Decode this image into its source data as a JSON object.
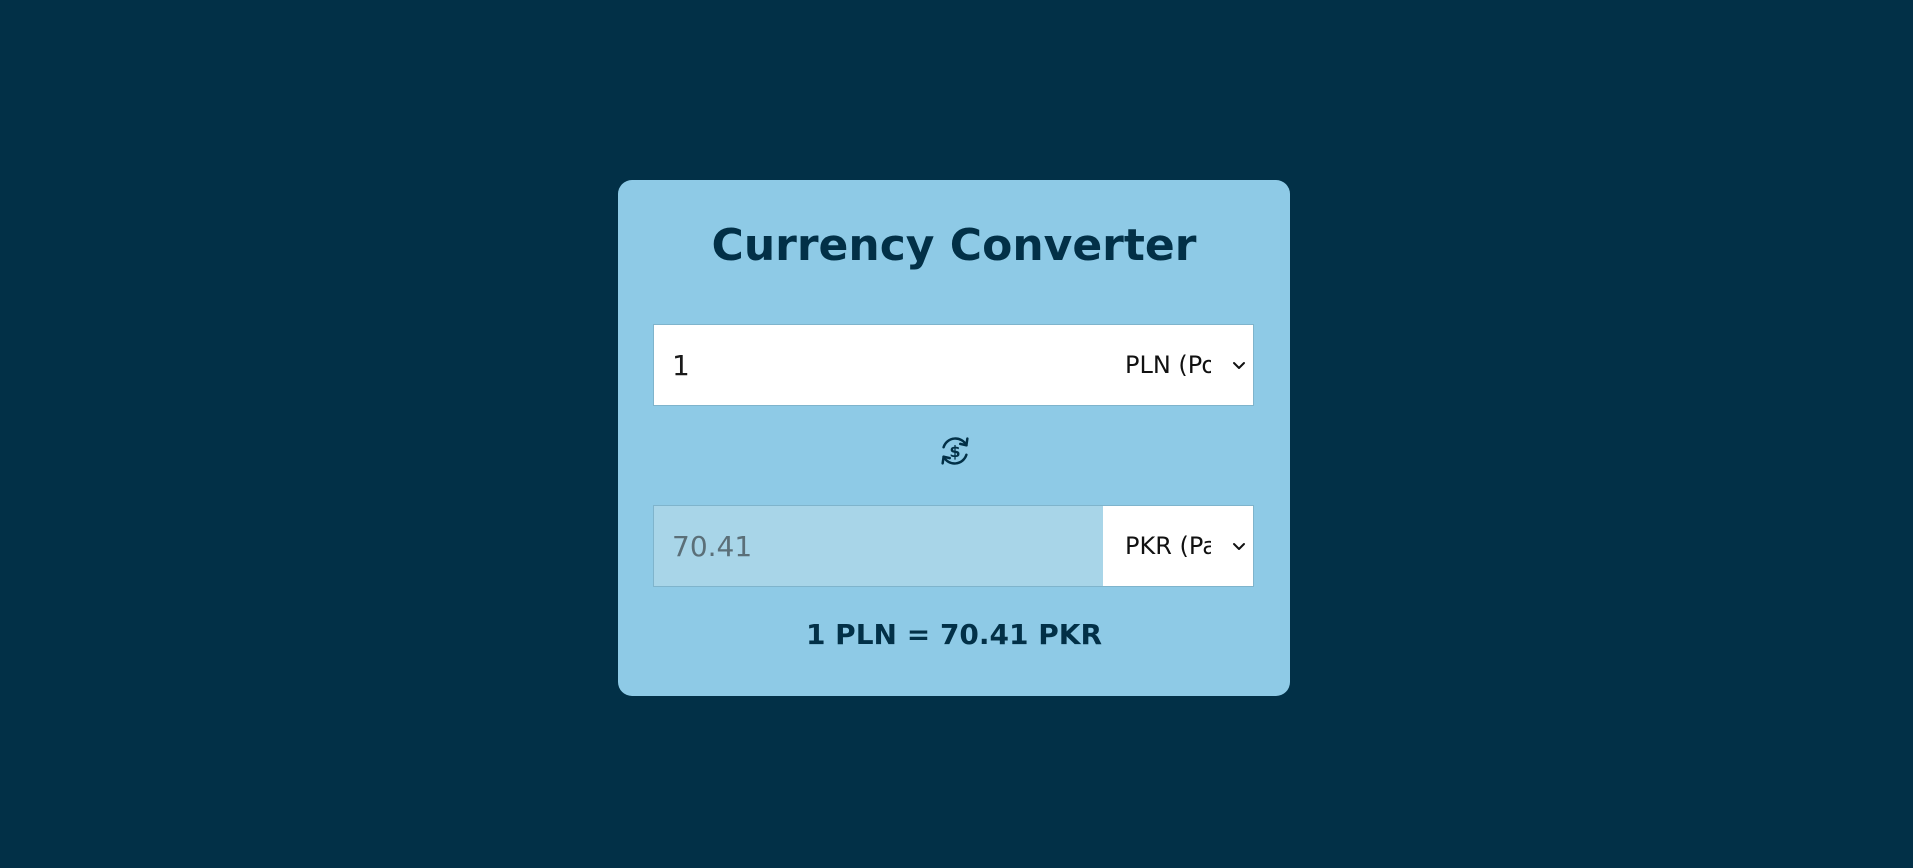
{
  "title": "Currency Converter",
  "from": {
    "amount": "1",
    "currency_label": "PLN (Polish Zloty)"
  },
  "to": {
    "amount": "70.41",
    "currency_label": "PKR (Pakistani Rupee)"
  },
  "rate_text": "1 PLN = 70.41 PKR",
  "icons": {
    "swap": "currency-swap-icon",
    "dropdown": "chevron-down-icon"
  },
  "colors": {
    "background": "#023047",
    "card": "#8ecae6",
    "text": "#023047"
  }
}
